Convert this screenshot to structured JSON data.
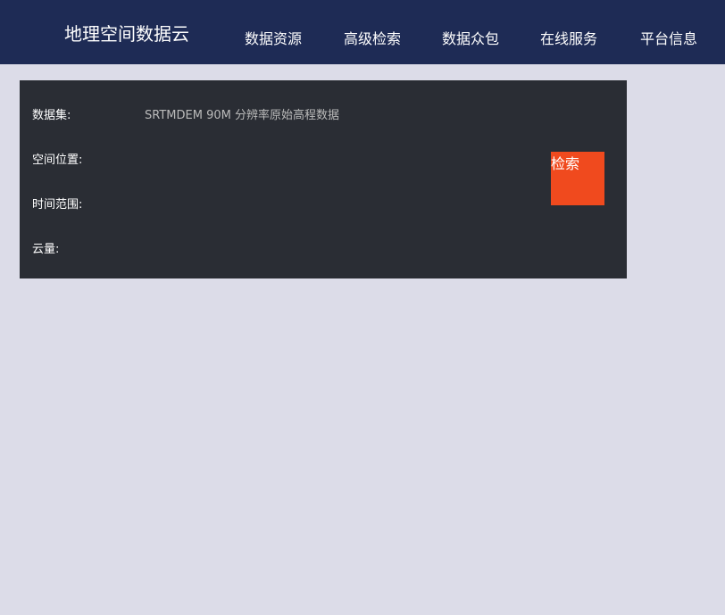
{
  "nav": {
    "brand": "地理空间数据云",
    "items": [
      "数据资源",
      "高级检索",
      "数据众包",
      "在线服务",
      "平台信息"
    ]
  },
  "panel": {
    "dataset_label": "数据集:",
    "dataset_value": "SRTMDEM 90M 分辨率原始高程数据",
    "location_label": "空间位置:",
    "time_label": "时间范围:",
    "cloud_label": "云量:",
    "search_label": "检索"
  }
}
